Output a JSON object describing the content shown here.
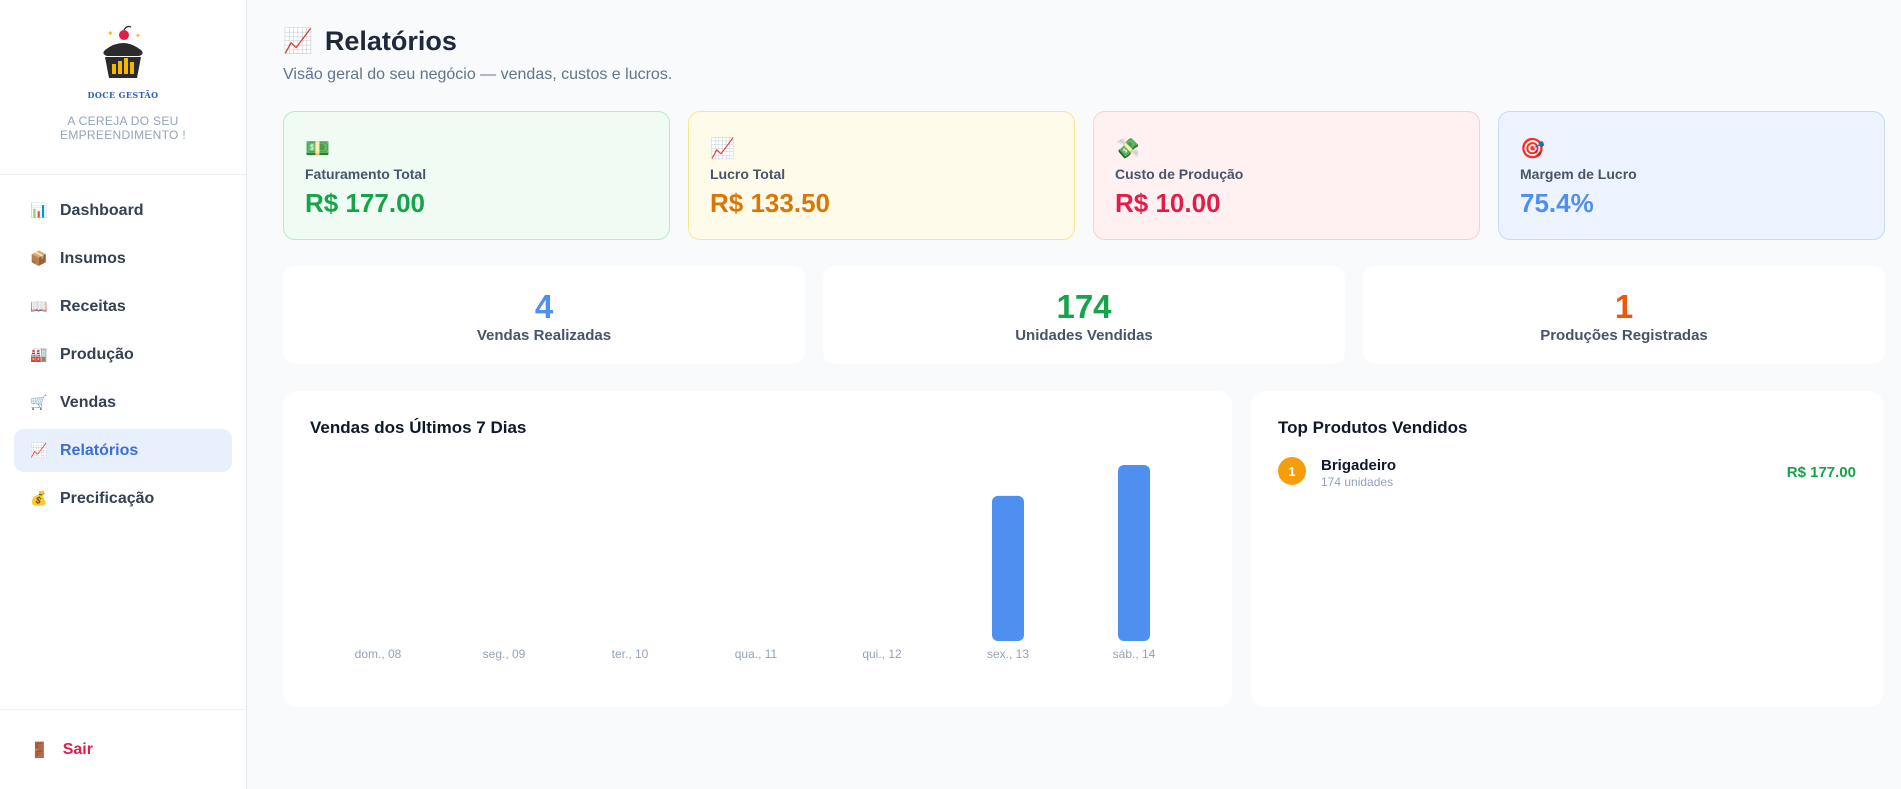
{
  "brand": {
    "name": "DOCE GESTÃO",
    "tagline": "A CEREJA DO SEU EMPREENDIMENTO !"
  },
  "nav": [
    {
      "label": "Dashboard",
      "icon": "📊",
      "icon_name": "bar-chart-icon"
    },
    {
      "label": "Insumos",
      "icon": "📦",
      "icon_name": "package-icon"
    },
    {
      "label": "Receitas",
      "icon": "📖",
      "icon_name": "book-icon"
    },
    {
      "label": "Produção",
      "icon": "🏭",
      "icon_name": "factory-icon"
    },
    {
      "label": "Vendas",
      "icon": "🛒",
      "icon_name": "cart-icon"
    },
    {
      "label": "Relatórios",
      "icon": "📈",
      "icon_name": "trend-chart-icon",
      "active": true
    },
    {
      "label": "Precificação",
      "icon": "💰",
      "icon_name": "money-bag-icon"
    }
  ],
  "logout": {
    "label": "Sair",
    "icon": "🚪",
    "icon_name": "door-icon"
  },
  "header": {
    "icon": "📈",
    "title": "Relatórios",
    "subtitle": "Visão geral do seu negócio — vendas, custos e lucros."
  },
  "stats": [
    {
      "icon": "💵",
      "label": "Faturamento Total",
      "value": "R$ 177.00",
      "color": "#16a34a"
    },
    {
      "icon": "📈",
      "label": "Lucro Total",
      "value": "R$ 133.50",
      "color": "#d97706"
    },
    {
      "icon": "💸",
      "label": "Custo de Produção",
      "value": "R$ 10.00",
      "color": "#e11d48"
    },
    {
      "icon": "🎯",
      "label": "Margem de Lucro",
      "value": "75.4%",
      "color": "#4f8ff0"
    }
  ],
  "counts": [
    {
      "value": "4",
      "label": "Vendas Realizadas",
      "color": "#4f8ff0"
    },
    {
      "value": "174",
      "label": "Unidades Vendidas",
      "color": "#16a34a"
    },
    {
      "value": "1",
      "label": "Produções Registradas",
      "color": "#ea580c"
    }
  ],
  "sales_chart_title": "Vendas dos Últimos 7 Dias",
  "chart_data": {
    "type": "bar",
    "title": "Vendas dos Últimos 7 Dias",
    "categories": [
      "dom., 08",
      "seg., 09",
      "ter., 10",
      "qua., 11",
      "qui., 12",
      "sex., 13",
      "sáb., 14"
    ],
    "values": [
      0,
      0,
      0,
      0,
      0,
      80,
      97
    ],
    "bar_color": "#4f8ff0",
    "grid": false
  },
  "top_products": {
    "title": "Top Produtos Vendidos",
    "items": [
      {
        "rank": "1",
        "name": "Brigadeiro",
        "units": "174 unidades",
        "value": "R$ 177.00"
      }
    ]
  }
}
